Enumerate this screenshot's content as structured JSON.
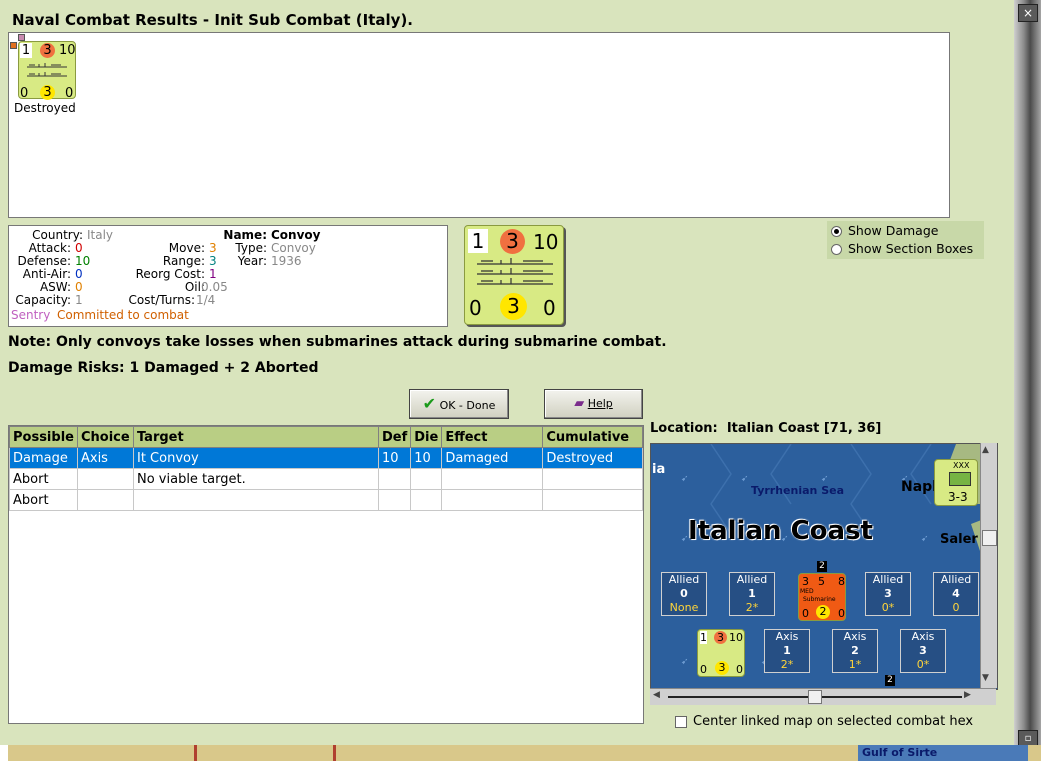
{
  "window": {
    "title": "Naval Combat Results - Init Sub Combat (Italy)."
  },
  "result_unit": {
    "attack": "1",
    "defense_top": "3",
    "range": "10",
    "bottom_left": "0",
    "bottom_mid": "3",
    "bottom_right": "0",
    "status": "Destroyed"
  },
  "unit_info": {
    "country_label": "Country:",
    "country": "Italy",
    "attack_label": "Attack:",
    "attack": "0",
    "defense_label": "Defense:",
    "defense": "10",
    "antiair_label": "Anti-Air:",
    "antiair": "0",
    "asw_label": "ASW:",
    "asw": "0",
    "capacity_label": "Capacity:",
    "capacity": "1",
    "move_label": "Move:",
    "move": "3",
    "range_label": "Range:",
    "range": "3",
    "reorg_label": "Reorg Cost:",
    "reorg": "1",
    "oil_label": "Oil:",
    "oil": "0.05",
    "costturns_label": "Cost/Turns:",
    "costturns": "1/4",
    "name_label": "Name:",
    "name": "Convoy",
    "type_label": "Type:",
    "type": "Convoy",
    "year_label": "Year:",
    "year": "1936",
    "sentry": "Sentry",
    "committed": "Committed to combat"
  },
  "big_counter": {
    "top_left": "1",
    "top_mid": "3",
    "top_right": "10",
    "bot_left": "0",
    "bot_mid": "3",
    "bot_right": "0"
  },
  "options": {
    "show_damage": "Show Damage",
    "show_section_boxes": "Show Section Boxes"
  },
  "note": "Note: Only convoys take losses when submarines attack during submarine combat.",
  "risks": "Damage Risks:  1 Damaged + 2 Aborted",
  "buttons": {
    "ok": "OK - Done",
    "help": "Help"
  },
  "table": {
    "headers": [
      "Possible",
      "Choice",
      "Target",
      "Def",
      "Die",
      "Effect",
      "Cumulative"
    ],
    "rows": [
      [
        "Damage",
        "Axis",
        "It Convoy",
        "10",
        "10",
        "Damaged",
        "Destroyed"
      ],
      [
        "Abort",
        "",
        "No viable target.",
        "",
        "",
        "",
        ""
      ],
      [
        "Abort",
        "",
        "",
        "",
        "",
        "",
        ""
      ]
    ]
  },
  "location": {
    "label": "Location:",
    "value": "Italian Coast [71, 36]"
  },
  "map": {
    "region": "Italian Coast",
    "sea": "Tyrrhenian Sea",
    "city1": "Napl",
    "city2": "Saler",
    "edge_text": "ia",
    "allied_boxes": [
      {
        "side": "Allied",
        "num": "0",
        "val": "None"
      },
      {
        "side": "Allied",
        "num": "1",
        "val": "2*"
      },
      {
        "side": "Allied",
        "num": "3",
        "val": "0*"
      },
      {
        "side": "Allied",
        "num": "4",
        "val": "0"
      }
    ],
    "axis_boxes": [
      {
        "side": "Axis",
        "num": "1",
        "val": "2*"
      },
      {
        "side": "Axis",
        "num": "2",
        "val": "1*"
      },
      {
        "side": "Axis",
        "num": "3",
        "val": "0*"
      }
    ],
    "sub_counter": {
      "a": "3",
      "b": "5",
      "c": "8",
      "d": "0",
      "e": "2",
      "f": "0",
      "label": "Submarine",
      "tag": "MED",
      "stack": "2"
    },
    "convoy_counter": {
      "a": "1",
      "b": "3",
      "c": "10",
      "d": "0",
      "e": "3",
      "f": "0"
    },
    "corps_counter": {
      "size": "XXX",
      "value": "3-3"
    },
    "bottom_stack": "2"
  },
  "center_checkbox": "Center linked map on selected combat hex",
  "bottom_strip": "Gulf of Sirte"
}
